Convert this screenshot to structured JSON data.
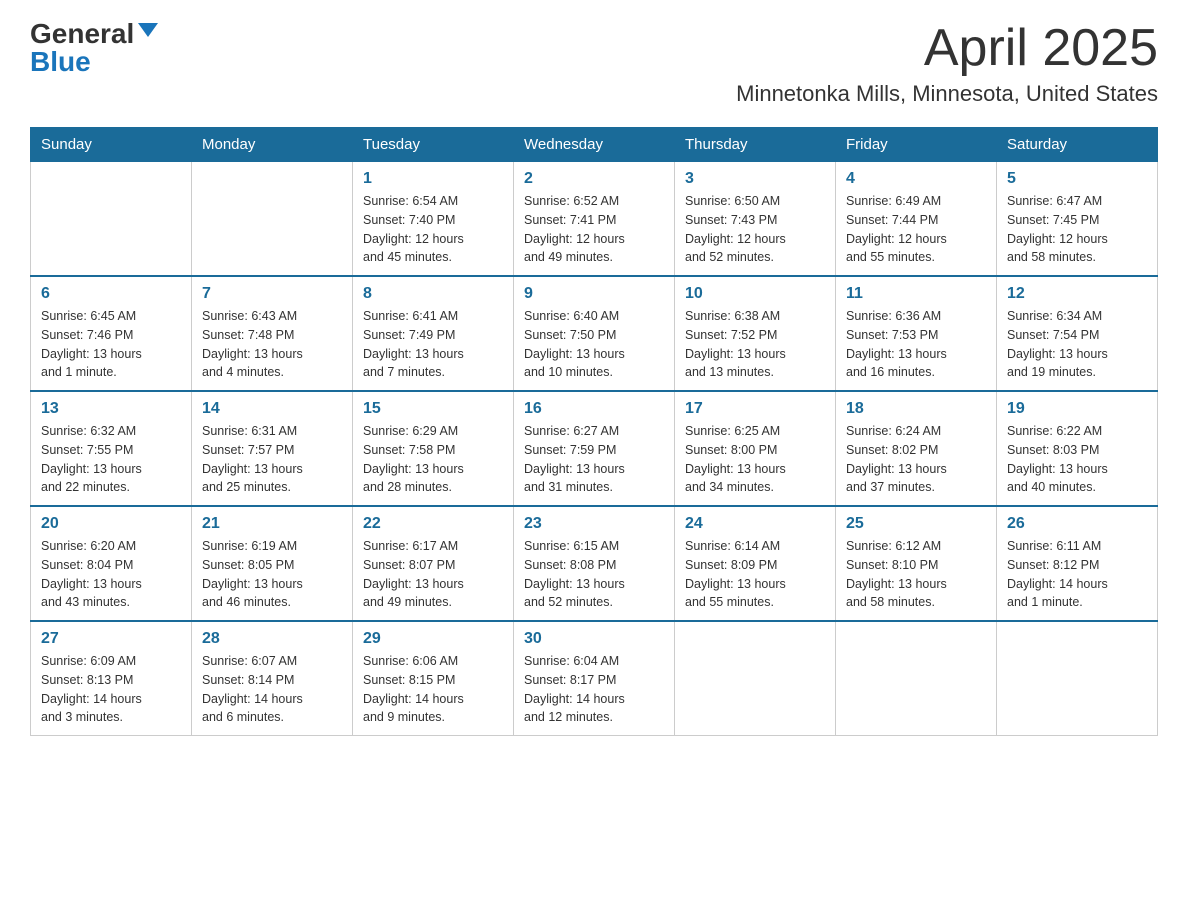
{
  "header": {
    "logo_general": "General",
    "logo_blue": "Blue",
    "title": "April 2025",
    "subtitle": "Minnetonka Mills, Minnesota, United States"
  },
  "days_of_week": [
    "Sunday",
    "Monday",
    "Tuesday",
    "Wednesday",
    "Thursday",
    "Friday",
    "Saturday"
  ],
  "weeks": [
    [
      {
        "num": "",
        "info": ""
      },
      {
        "num": "",
        "info": ""
      },
      {
        "num": "1",
        "info": "Sunrise: 6:54 AM\nSunset: 7:40 PM\nDaylight: 12 hours\nand 45 minutes."
      },
      {
        "num": "2",
        "info": "Sunrise: 6:52 AM\nSunset: 7:41 PM\nDaylight: 12 hours\nand 49 minutes."
      },
      {
        "num": "3",
        "info": "Sunrise: 6:50 AM\nSunset: 7:43 PM\nDaylight: 12 hours\nand 52 minutes."
      },
      {
        "num": "4",
        "info": "Sunrise: 6:49 AM\nSunset: 7:44 PM\nDaylight: 12 hours\nand 55 minutes."
      },
      {
        "num": "5",
        "info": "Sunrise: 6:47 AM\nSunset: 7:45 PM\nDaylight: 12 hours\nand 58 minutes."
      }
    ],
    [
      {
        "num": "6",
        "info": "Sunrise: 6:45 AM\nSunset: 7:46 PM\nDaylight: 13 hours\nand 1 minute."
      },
      {
        "num": "7",
        "info": "Sunrise: 6:43 AM\nSunset: 7:48 PM\nDaylight: 13 hours\nand 4 minutes."
      },
      {
        "num": "8",
        "info": "Sunrise: 6:41 AM\nSunset: 7:49 PM\nDaylight: 13 hours\nand 7 minutes."
      },
      {
        "num": "9",
        "info": "Sunrise: 6:40 AM\nSunset: 7:50 PM\nDaylight: 13 hours\nand 10 minutes."
      },
      {
        "num": "10",
        "info": "Sunrise: 6:38 AM\nSunset: 7:52 PM\nDaylight: 13 hours\nand 13 minutes."
      },
      {
        "num": "11",
        "info": "Sunrise: 6:36 AM\nSunset: 7:53 PM\nDaylight: 13 hours\nand 16 minutes."
      },
      {
        "num": "12",
        "info": "Sunrise: 6:34 AM\nSunset: 7:54 PM\nDaylight: 13 hours\nand 19 minutes."
      }
    ],
    [
      {
        "num": "13",
        "info": "Sunrise: 6:32 AM\nSunset: 7:55 PM\nDaylight: 13 hours\nand 22 minutes."
      },
      {
        "num": "14",
        "info": "Sunrise: 6:31 AM\nSunset: 7:57 PM\nDaylight: 13 hours\nand 25 minutes."
      },
      {
        "num": "15",
        "info": "Sunrise: 6:29 AM\nSunset: 7:58 PM\nDaylight: 13 hours\nand 28 minutes."
      },
      {
        "num": "16",
        "info": "Sunrise: 6:27 AM\nSunset: 7:59 PM\nDaylight: 13 hours\nand 31 minutes."
      },
      {
        "num": "17",
        "info": "Sunrise: 6:25 AM\nSunset: 8:00 PM\nDaylight: 13 hours\nand 34 minutes."
      },
      {
        "num": "18",
        "info": "Sunrise: 6:24 AM\nSunset: 8:02 PM\nDaylight: 13 hours\nand 37 minutes."
      },
      {
        "num": "19",
        "info": "Sunrise: 6:22 AM\nSunset: 8:03 PM\nDaylight: 13 hours\nand 40 minutes."
      }
    ],
    [
      {
        "num": "20",
        "info": "Sunrise: 6:20 AM\nSunset: 8:04 PM\nDaylight: 13 hours\nand 43 minutes."
      },
      {
        "num": "21",
        "info": "Sunrise: 6:19 AM\nSunset: 8:05 PM\nDaylight: 13 hours\nand 46 minutes."
      },
      {
        "num": "22",
        "info": "Sunrise: 6:17 AM\nSunset: 8:07 PM\nDaylight: 13 hours\nand 49 minutes."
      },
      {
        "num": "23",
        "info": "Sunrise: 6:15 AM\nSunset: 8:08 PM\nDaylight: 13 hours\nand 52 minutes."
      },
      {
        "num": "24",
        "info": "Sunrise: 6:14 AM\nSunset: 8:09 PM\nDaylight: 13 hours\nand 55 minutes."
      },
      {
        "num": "25",
        "info": "Sunrise: 6:12 AM\nSunset: 8:10 PM\nDaylight: 13 hours\nand 58 minutes."
      },
      {
        "num": "26",
        "info": "Sunrise: 6:11 AM\nSunset: 8:12 PM\nDaylight: 14 hours\nand 1 minute."
      }
    ],
    [
      {
        "num": "27",
        "info": "Sunrise: 6:09 AM\nSunset: 8:13 PM\nDaylight: 14 hours\nand 3 minutes."
      },
      {
        "num": "28",
        "info": "Sunrise: 6:07 AM\nSunset: 8:14 PM\nDaylight: 14 hours\nand 6 minutes."
      },
      {
        "num": "29",
        "info": "Sunrise: 6:06 AM\nSunset: 8:15 PM\nDaylight: 14 hours\nand 9 minutes."
      },
      {
        "num": "30",
        "info": "Sunrise: 6:04 AM\nSunset: 8:17 PM\nDaylight: 14 hours\nand 12 minutes."
      },
      {
        "num": "",
        "info": ""
      },
      {
        "num": "",
        "info": ""
      },
      {
        "num": "",
        "info": ""
      }
    ]
  ]
}
